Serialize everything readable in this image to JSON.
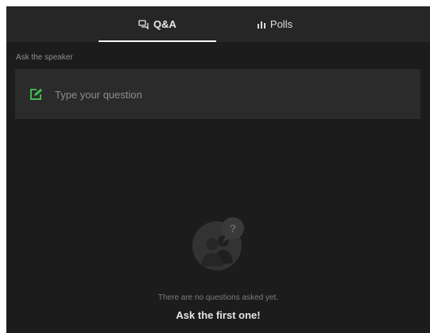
{
  "tabs": {
    "qa": {
      "label": "Q&A",
      "icon": "chat-bubbles-icon",
      "active": true
    },
    "polls": {
      "label": "Polls",
      "icon": "bar-chart-icon",
      "active": false
    }
  },
  "ask_section": {
    "caption": "Ask the speaker",
    "input_placeholder": "Type your question",
    "input_value": "",
    "icon": "compose-icon"
  },
  "empty_state": {
    "icon": "people-question-icon",
    "message": "There are no questions asked yet.",
    "cta": "Ask the first one!"
  },
  "colors": {
    "background": "#1c1c1c",
    "header": "#262626",
    "input_bg": "#2b2b2b",
    "accent_green": "#3fb950",
    "active_underline": "#ffffff"
  }
}
